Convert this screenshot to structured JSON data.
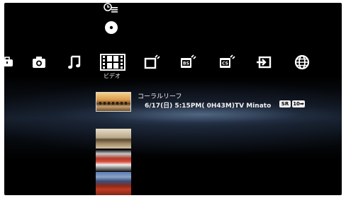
{
  "xmb": {
    "vertical_icons": [
      {
        "icon": "schedule-list-icon"
      },
      {
        "icon": "disc-icon"
      }
    ],
    "categories": [
      {
        "icon": "settings-toolbox-icon"
      },
      {
        "icon": "camera-icon"
      },
      {
        "icon": "music-note-icon"
      },
      {
        "icon": "film-strip-icon",
        "label": "ビデオ",
        "selected": true
      },
      {
        "icon": "tv-antenna-icon"
      },
      {
        "icon": "bs-tv-icon",
        "badge": "BS"
      },
      {
        "icon": "cs-tv-icon",
        "badge": "CS"
      },
      {
        "icon": "input-switch-icon"
      },
      {
        "icon": "globe-icon"
      }
    ],
    "selected_label": "ビデオ"
  },
  "recording": {
    "title": "コーラルリーフ",
    "info": "6/17(日) 5:15PM( 0H43M)TV Minato",
    "badge_sr": "SR",
    "badge_flag": "10➡"
  },
  "thumbnails": [
    {
      "name": "recording-thumb-1"
    },
    {
      "name": "recording-thumb-2"
    },
    {
      "name": "recording-thumb-3"
    }
  ]
}
